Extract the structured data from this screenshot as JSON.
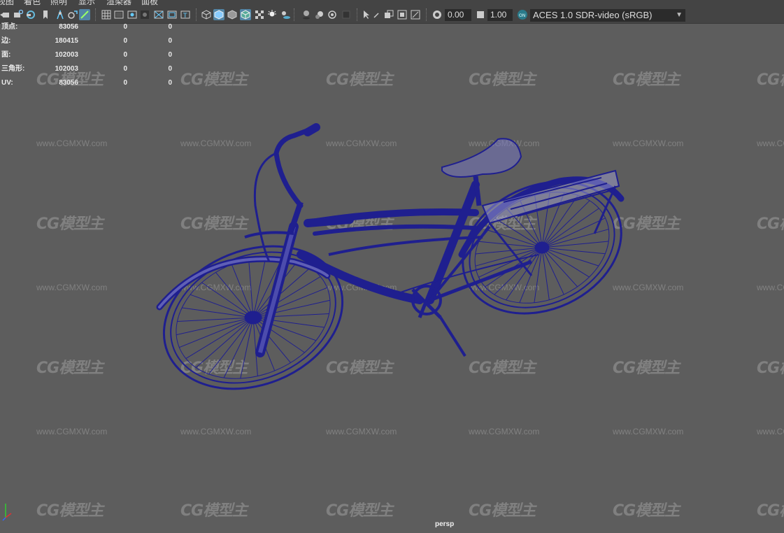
{
  "menu": {
    "items": [
      "视图",
      "着色",
      "照明",
      "显示",
      "渲染器",
      "面板"
    ]
  },
  "toolbar": {
    "icons": [
      "camera-icon",
      "camera-lock-icon",
      "bookmark-icon",
      "pin-icon",
      "move-pivot-icon",
      "grease-pencil-icon",
      "grid-icon",
      "film-gate-icon",
      "resolution-gate-icon",
      "gate-mask-icon",
      "field-chart-icon",
      "safe-action-icon",
      "safe-title-icon",
      "wireframe-icon",
      "smooth-shade-icon",
      "textured-icon",
      "use-all-lights-icon",
      "shadows-icon",
      "ambient-occlusion-icon",
      "screen-space-ao-icon",
      "motion-blur-icon",
      "anti-alias-icon",
      "depth-of-field-icon",
      "isolate-select-icon",
      "xray-icon",
      "xray-joints-icon",
      "xray-components-icon",
      "exposure-icon",
      "gamma-icon",
      "color-management-icon"
    ],
    "exposure_value": "0.00",
    "gamma_value": "1.00",
    "color_space": "ACES 1.0 SDR-video (sRGB)"
  },
  "stats": {
    "rows": [
      {
        "label": "顶点:",
        "v1": "83056",
        "v2": "0",
        "v3": "0"
      },
      {
        "label": "边:",
        "v1": "180415",
        "v2": "0",
        "v3": "0"
      },
      {
        "label": "面:",
        "v1": "102003",
        "v2": "0",
        "v3": "0"
      },
      {
        "label": "三角形:",
        "v1": "102003",
        "v2": "0",
        "v3": "0"
      },
      {
        "label": "UV:",
        "v1": "83056",
        "v2": "0",
        "v3": "0"
      }
    ]
  },
  "watermark": {
    "logo_text": "CG模型主",
    "url_text": "www.CGMXW.com"
  },
  "viewport": {
    "camera": "persp",
    "background_color": "#5d5d5d",
    "wireframe_color": "#1f1f8f"
  }
}
